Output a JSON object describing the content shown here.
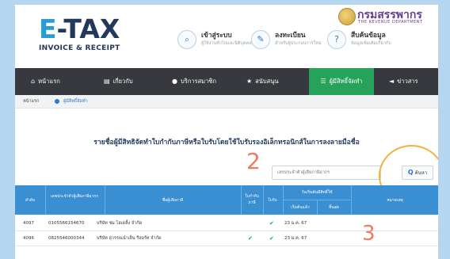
{
  "logo": {
    "mark_e": "E",
    "mark_rest": "-TAX",
    "subtitle": "INVOICE & RECEIPT"
  },
  "revenue": {
    "th": "กรมสรรพากร",
    "en": "THE REVENUE DEPARTMENT"
  },
  "header_links": [
    {
      "icon": "key-icon",
      "title": "เข้าสู่ระบบ",
      "desc": "ผู้ใช้งานทั่วไปและนิติบุคคล"
    },
    {
      "icon": "edit-icon",
      "title": "ลงทะเบียน",
      "desc": "สำหรับผู้ประกอบการใหม่"
    },
    {
      "icon": "help-icon",
      "title": "สืบค้นข้อมูล",
      "desc": "ข้อมูลเพิ่มเติมเกี่ยวกับ"
    }
  ],
  "nav": [
    {
      "icon": "home-icon",
      "label": "หน้าแรก"
    },
    {
      "icon": "document-icon",
      "label": "เกี่ยวกับ"
    },
    {
      "icon": "user-icon",
      "label": "บริการสมาชิก"
    },
    {
      "icon": "star-icon",
      "label": "สนับสนุน"
    },
    {
      "icon": "list-icon",
      "label": "ผู้มีสิทธิ์จัดทำ"
    },
    {
      "icon": "megaphone-icon",
      "label": "ข่าวสาร"
    }
  ],
  "breadcrumb": {
    "home": "หน้าแรก",
    "current": "ผู้มีสิทธิ์จัดทำ"
  },
  "page_title": "รายชื่อผู้มีสิทธิจัดทำใบกำกับภาษีหรือใบรับโดยใช้ใบรับรองอิเล็กทรอนิกส์ในการลงลายมือชื่อ",
  "search": {
    "placeholder": "เลขประจำตัวผู้เสียภาษีอากร",
    "button_label": "ค้นหา"
  },
  "annotations": {
    "step2": "2",
    "step3": "3"
  },
  "table": {
    "headers": {
      "no": "ลำดับ",
      "taxid": "เลขประจำตัวผู้เสียภาษีอากร",
      "name": "ชื่อผู้เสียภาษี",
      "invoice": "ใบกำกับภาษี",
      "receipt": "ใบรับ",
      "dates": "วันเริ่มต้นมีสิทธิ์ใช้",
      "start": "เริ่มต้นแล้ว",
      "end": "สิ้นสุด",
      "note": "หมายเหตุ"
    },
    "rows": [
      {
        "no": "4097",
        "taxid": "0105566154670",
        "name": "บริษัท ชม ไฮเดลิ้ง จำกัด",
        "invoice": "",
        "receipt": "✔",
        "start": "23 ม.ค. 67"
      },
      {
        "no": "4096",
        "taxid": "0825546000344",
        "name": "บริษัท สุวรรณนำเย็น รีสอร์ท จำกัด",
        "invoice": "✔",
        "receipt": "✔",
        "start": "23 ม.ค. 67"
      }
    ]
  }
}
